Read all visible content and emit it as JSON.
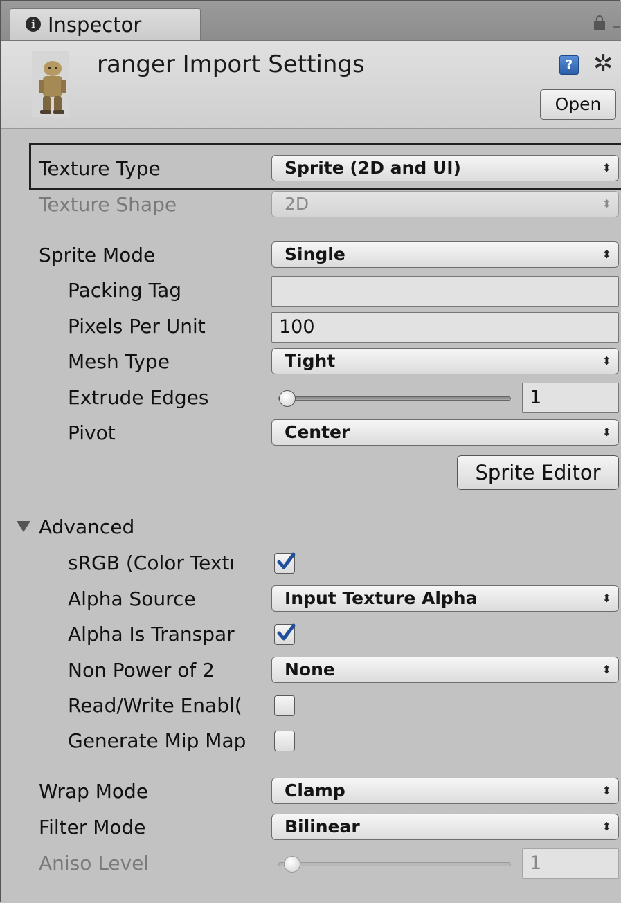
{
  "tab": {
    "label": "Inspector",
    "info_glyph": "i"
  },
  "header": {
    "title": "ranger Import Settings",
    "help_glyph": "?",
    "open_label": "Open"
  },
  "rows": {
    "texture_type": {
      "label": "Texture Type",
      "value": "Sprite (2D and UI)"
    },
    "texture_shape": {
      "label": "Texture Shape",
      "value": "2D"
    },
    "sprite_mode": {
      "label": "Sprite Mode",
      "value": "Single"
    },
    "packing_tag": {
      "label": "Packing Tag",
      "value": ""
    },
    "pixels_per_unit": {
      "label": "Pixels Per Unit",
      "value": "100"
    },
    "mesh_type": {
      "label": "Mesh Type",
      "value": "Tight"
    },
    "extrude_edges": {
      "label": "Extrude Edges",
      "value": "1"
    },
    "pivot": {
      "label": "Pivot",
      "value": "Center"
    },
    "sprite_editor_label": "Sprite Editor",
    "advanced_label": "Advanced",
    "srgb": {
      "label": "sRGB (Color Textı",
      "checked": true
    },
    "alpha_source": {
      "label": "Alpha Source",
      "value": "Input Texture Alpha"
    },
    "alpha_is_transparency": {
      "label": "Alpha Is Transpar",
      "checked": true
    },
    "non_power_of_2": {
      "label": "Non Power of 2",
      "value": "None"
    },
    "read_write": {
      "label": "Read/Write Enabl(",
      "checked": false
    },
    "generate_mip_maps": {
      "label": "Generate Mip Map",
      "checked": false
    },
    "wrap_mode": {
      "label": "Wrap Mode",
      "value": "Clamp"
    },
    "filter_mode": {
      "label": "Filter Mode",
      "value": "Bilinear"
    },
    "aniso_level": {
      "label": "Aniso Level",
      "value": "1"
    }
  },
  "dropdown_arrow_glyph": "⬍",
  "gear_glyph": "✲",
  "icons": {
    "info": "info-icon",
    "lock": "lock-icon",
    "help": "help-icon",
    "gear": "gear-icon",
    "check": "checkmark-icon"
  },
  "colors": {
    "panel_bg": "#c2c2c2",
    "check_blue": "#1f4f9c"
  }
}
